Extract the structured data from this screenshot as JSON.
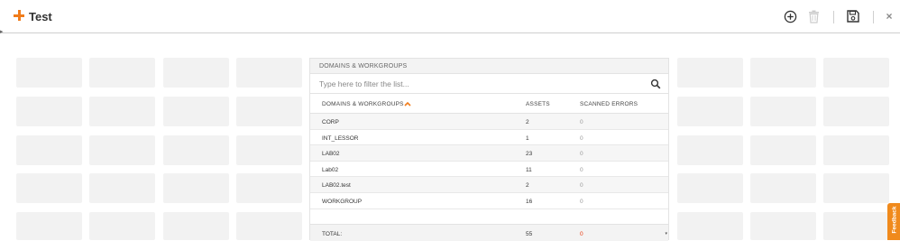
{
  "header": {
    "title": "Test",
    "accent_color": "#f07c1b",
    "icons": [
      "add-circle-icon",
      "trash-icon",
      "save-icon",
      "close-icon"
    ],
    "close_glyph": "×"
  },
  "panel": {
    "title": "DOMAINS & WORKGROUPS",
    "filter_placeholder": "Type here to filter the list...",
    "columns": {
      "name": "DOMAINS & WORKGROUPS",
      "assets": "ASSETS",
      "errors": "SCANNED ERRORS"
    },
    "rows": [
      {
        "name": "CORP",
        "assets": "2",
        "errors": "0"
      },
      {
        "name": "INT_LESSOR",
        "assets": "1",
        "errors": "0"
      },
      {
        "name": "LAB02",
        "assets": "23",
        "errors": "0"
      },
      {
        "name": "Lab02",
        "assets": "11",
        "errors": "0"
      },
      {
        "name": "LAB02.test",
        "assets": "2",
        "errors": "0"
      },
      {
        "name": "WORKGROUP",
        "assets": "16",
        "errors": "0"
      }
    ],
    "total": {
      "label": "TOTAL:",
      "assets": "55",
      "errors": "0"
    },
    "error_total_color": "#e8380d"
  },
  "feedback": {
    "label": "Feedback",
    "color": "#f08a1c"
  }
}
